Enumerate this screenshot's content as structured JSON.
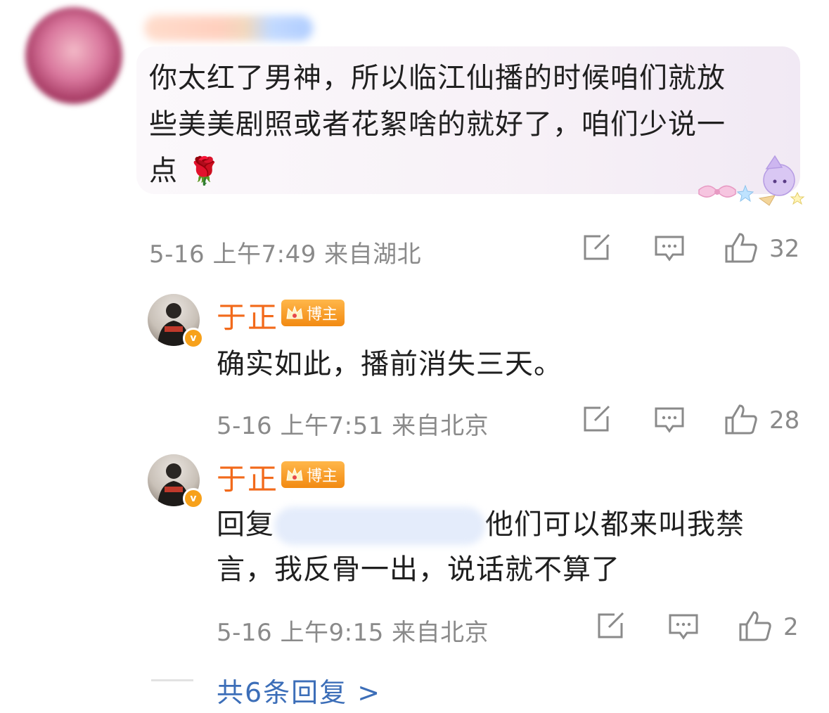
{
  "comment": {
    "text_line1": "你太红了男神，所以临江仙播的时候咱们就放",
    "text_line2": "些美美剧照或者花絮啥的就好了，咱们少说一",
    "text_line3": "点",
    "rose_emoji": "🌹",
    "date": "5-16",
    "time": "上午7:49",
    "location": "来自湖北",
    "likes": "32"
  },
  "replies": [
    {
      "name": "于正",
      "badge": "博主",
      "text": "确实如此，播前消失三天。",
      "date": "5-16",
      "time": "上午7:51",
      "location": "来自北京",
      "likes": "28"
    },
    {
      "name": "于正",
      "badge": "博主",
      "reply_prefix": "回复",
      "text_line1": "他们可以都来叫我禁",
      "text_line2": "言，我反骨一出，说话就不算了",
      "date": "5-16",
      "time": "上午9:15",
      "location": "来自北京",
      "likes": "2"
    }
  ],
  "more_replies": "共6条回复 >",
  "colors": {
    "username": "#f26a1b",
    "link": "#3c6eb8",
    "meta": "#8a8a8a",
    "badge": "#f28a12"
  },
  "icons": [
    "share-icon",
    "comment-icon",
    "like-icon",
    "crown-icon",
    "verified-icon"
  ]
}
